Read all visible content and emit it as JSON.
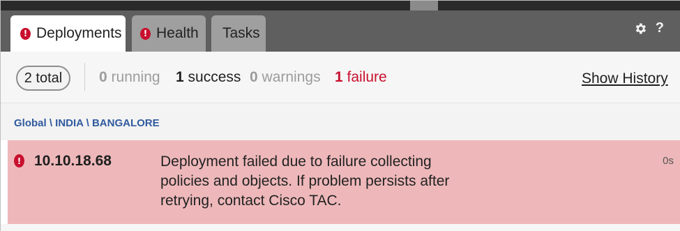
{
  "tabs": [
    {
      "label": "Deployments",
      "alert_icon": "alert-icon",
      "active": true
    },
    {
      "label": "Health",
      "alert_icon": "alert-icon",
      "active": false
    },
    {
      "label": "Tasks",
      "active": false
    }
  ],
  "toolbar": {
    "settings_icon": "gear-icon",
    "help_label": "?"
  },
  "summary": {
    "total_label": "2 total",
    "running": {
      "count": "0",
      "label": "running"
    },
    "success": {
      "count": "1",
      "label": "success"
    },
    "warnings": {
      "count": "0",
      "label": "warnings"
    },
    "failure": {
      "count": "1",
      "label": "failure"
    },
    "show_history_label": "Show History"
  },
  "breadcrumb": "Global \\ INDIA \\ BANGALORE",
  "deployment": {
    "device": "10.10.18.68",
    "message": "Deployment failed due to failure collecting policies and objects. If problem persists after retrying, contact Cisco TAC.",
    "duration": "0s",
    "status_icon": "alert-icon"
  },
  "colors": {
    "failure": "#c8102e",
    "row_failure_bg": "#eeb8ba",
    "link_blue": "#2f5a9e",
    "tabbar_bg": "#5f5f5f"
  }
}
